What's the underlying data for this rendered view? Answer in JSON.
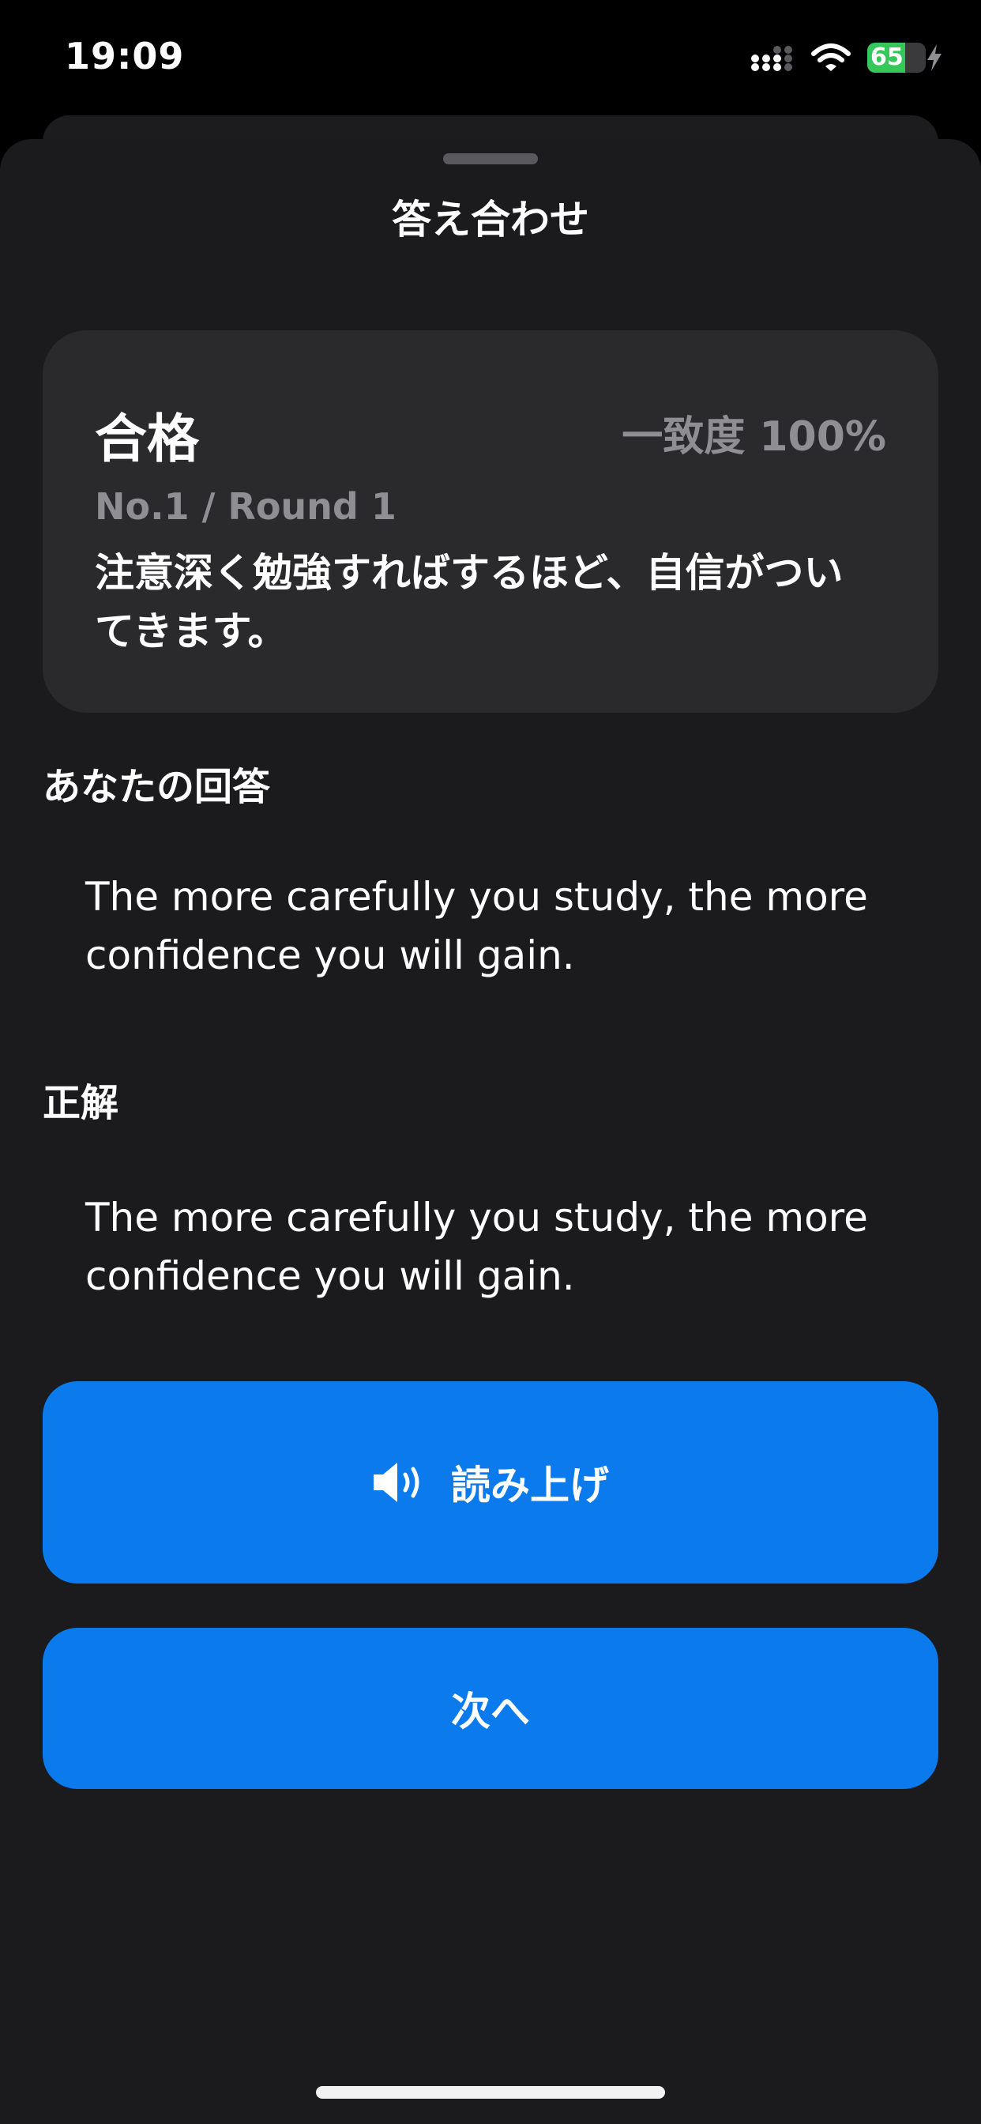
{
  "status_bar": {
    "time": "19:09",
    "battery_percent": 65,
    "battery_label": "65",
    "icons": [
      "signal-icon",
      "wifi-icon",
      "battery-icon",
      "charging-bolt-icon"
    ]
  },
  "sheet": {
    "title": "答え合わせ"
  },
  "result": {
    "status": "合格",
    "score_label": "一致度 100%",
    "round_label": "No.1 / Round 1",
    "prompt": "注意深く勉強すればするほど、自信がついてきます。"
  },
  "your_answer": {
    "label": "あなたの回答",
    "text": "The more carefully you study, the more confidence you will gain."
  },
  "correct_answer": {
    "label": "正解",
    "text": "The more carefully you study, the more confidence you will gain."
  },
  "buttons": {
    "read_aloud": "読み上げ",
    "next": "次へ"
  },
  "colors": {
    "accent": "#0a7aed",
    "battery": "#34c759",
    "sheet_background": "#1b1b1d",
    "card_background": "#2a2a2d",
    "secondary_text": "#8e8e93"
  }
}
